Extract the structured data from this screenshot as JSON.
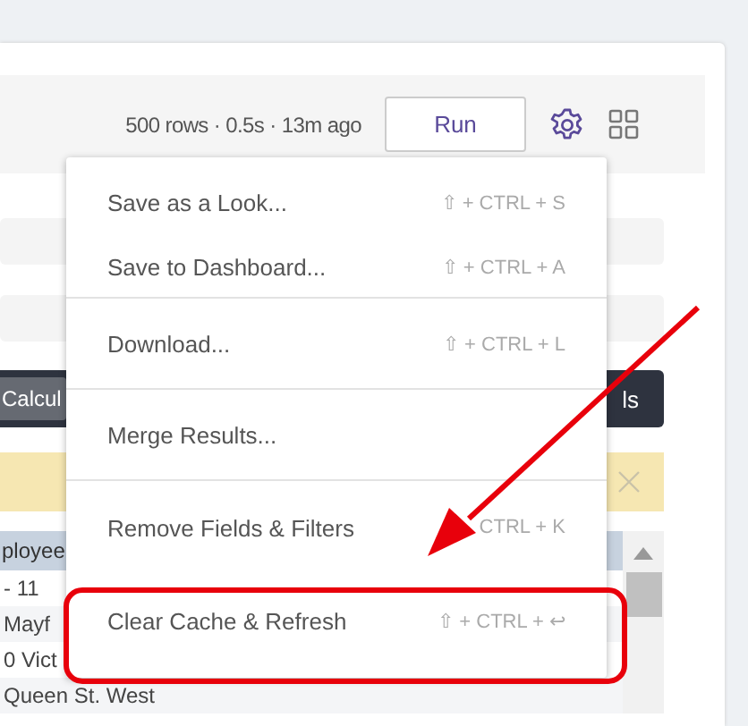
{
  "toolbar": {
    "stats": "500 rows · 0.5s · 13m ago",
    "run_button": "Run"
  },
  "action_bar": {
    "left_button": "Calcul",
    "right_button": "ls"
  },
  "table": {
    "header": "ployee",
    "rows": [
      "- 11",
      "Mayf",
      "0 Vict",
      "Queen St. West"
    ]
  },
  "menu": {
    "groups": [
      [
        {
          "label": "Save as a Look...",
          "shortcut": "⇧ + CTRL + S"
        },
        {
          "label": "Save to Dashboard...",
          "shortcut": "⇧ + CTRL + A"
        }
      ],
      [
        {
          "label": "Download...",
          "shortcut": "⇧ + CTRL + L"
        }
      ],
      [
        {
          "label": "Merge Results..."
        }
      ],
      [
        {
          "label": "Remove Fields & Filters",
          "shortcut": "CTRL + K"
        },
        {
          "label": "Clear Cache & Refresh",
          "shortcut": "⇧ + CTRL + ↩"
        }
      ]
    ]
  }
}
